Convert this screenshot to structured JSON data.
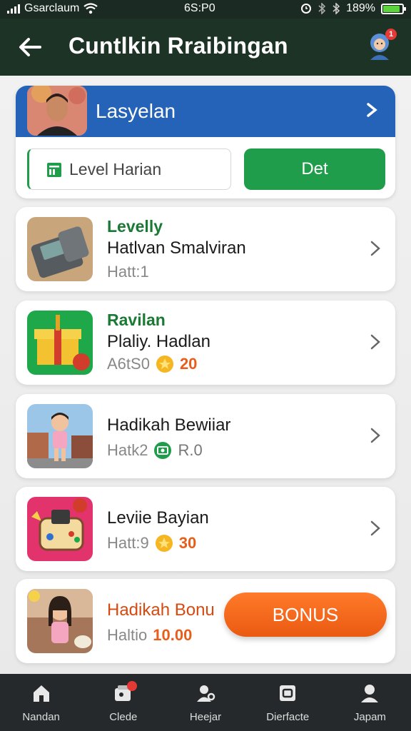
{
  "status_bar": {
    "carrier": "Gsarclaum",
    "time": "6S:P0",
    "battery": "189%",
    "battery_level": 0.9
  },
  "app_bar": {
    "title": "Cuntlkin Rraibingan",
    "notification_count": "1"
  },
  "profile": {
    "name": "Lasyelan",
    "level_label": "Level Harian",
    "details_button": "Det"
  },
  "items": [
    {
      "tag": "Levelly",
      "title": "Hatlvan Smalviran",
      "meta": "Hatt:1",
      "reward": "",
      "thumb": "scanner"
    },
    {
      "tag": "Ravilan",
      "title": "Plaliy. Hadlan",
      "meta": "A6tS0",
      "reward": "20",
      "thumb": "gift"
    },
    {
      "tag": "",
      "title": "Hadikah Bewiiar",
      "meta": "Hatk2",
      "reward": "R.0",
      "thumb": "child"
    },
    {
      "tag": "",
      "title": "Leviie Bayian",
      "meta": "Hatt:9",
      "reward": "30",
      "thumb": "console"
    },
    {
      "tag": "",
      "title": "Hadikah Bonu",
      "meta": "Haltio",
      "reward": "10.00",
      "thumb": "girl"
    }
  ],
  "bonus_button": "BONUS",
  "bottom_nav": [
    {
      "label": "Nandan",
      "icon": "home-icon"
    },
    {
      "label": "Clede",
      "icon": "cards-icon"
    },
    {
      "label": "Heejar",
      "icon": "user-gear-icon"
    },
    {
      "label": "Dierfacte",
      "icon": "copy-icon"
    },
    {
      "label": "Japam",
      "icon": "profile-icon"
    }
  ],
  "colors": {
    "app_bar": "#1d3326",
    "accent_green": "#1f9d4a",
    "profile_header": "#2563b8",
    "bonus_orange": "#ea5a12"
  }
}
